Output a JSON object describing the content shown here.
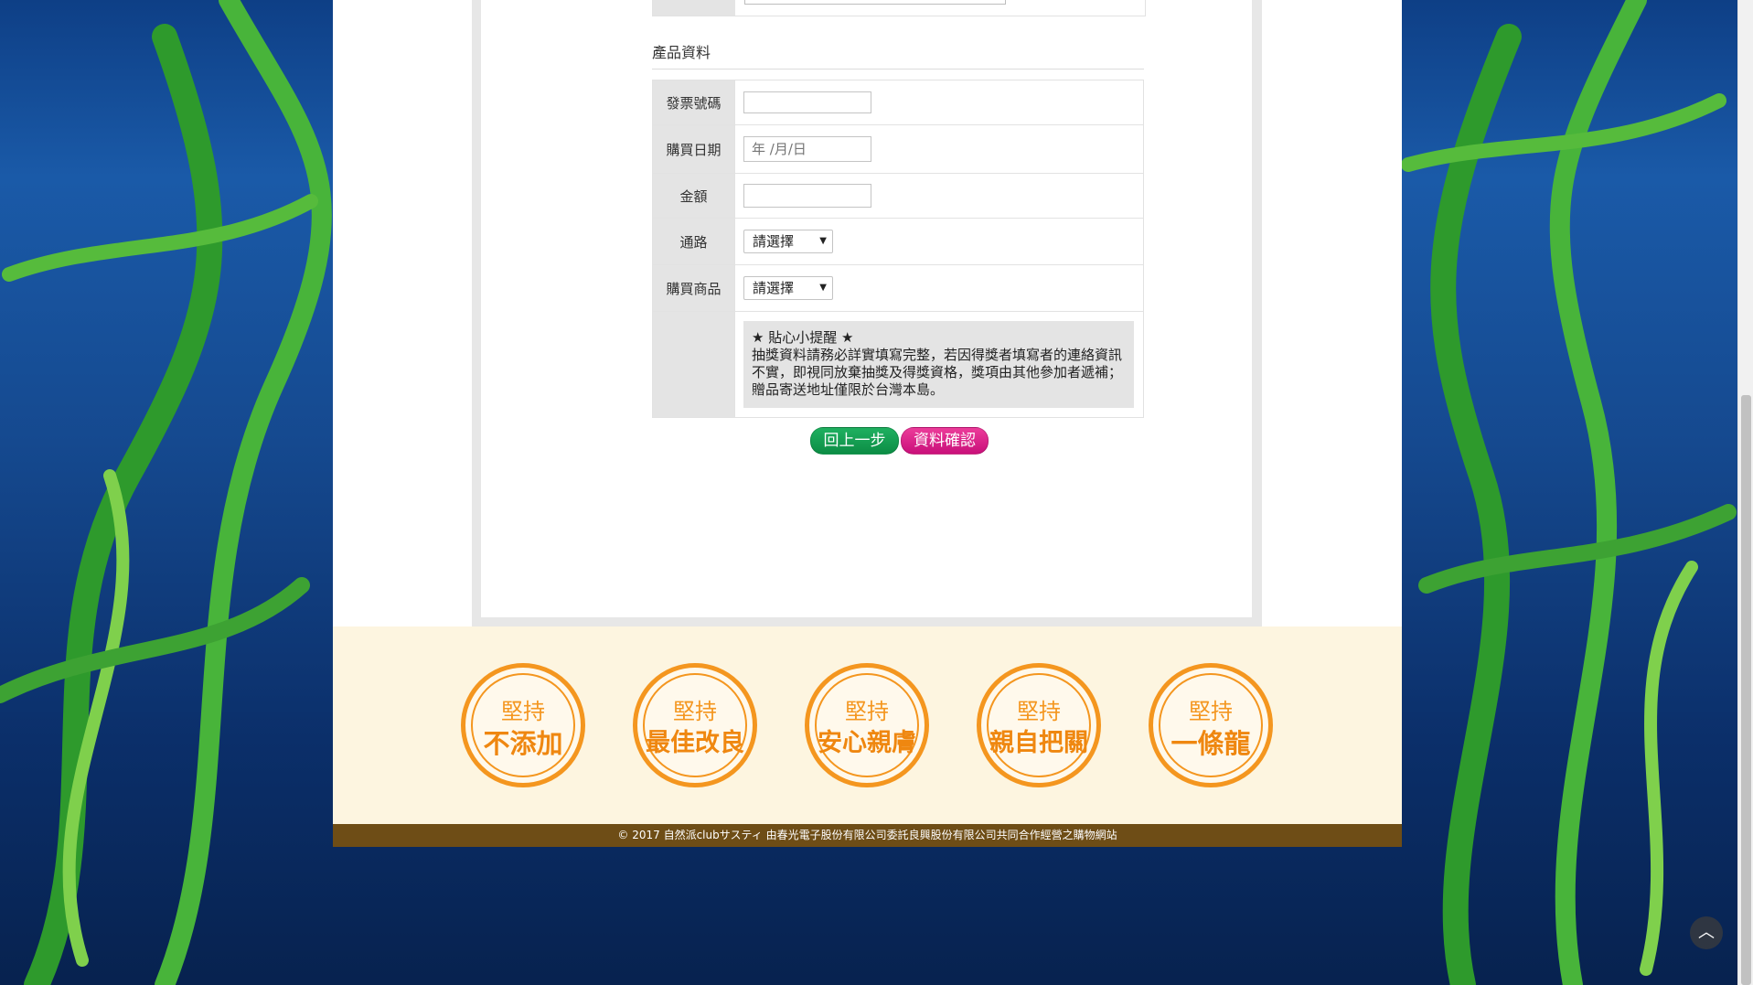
{
  "section": {
    "title": "產品資料"
  },
  "form": {
    "invoice_label": "發票號碼",
    "date_label": "購買日期",
    "date_placeholder": "年 /月/日",
    "amount_label": "金額",
    "channel_label": "通路",
    "channel_value": "請選擇",
    "product_label": "購買商品",
    "product_value": "請選擇"
  },
  "notice": {
    "title": "★ 貼心小提醒 ★",
    "body": "抽獎資料請務必詳實填寫完整，若因得獎者填寫者的連絡資訊不實，即視同放棄抽獎及得獎資格，獎項由其他參加者遞補；贈品寄送地址僅限於台灣本島。"
  },
  "buttons": {
    "back": "回上一步",
    "confirm": "資料確認"
  },
  "badges": [
    {
      "line1": "堅持",
      "line2": "不添加"
    },
    {
      "line1": "堅持",
      "line2": "最佳改良"
    },
    {
      "line1": "堅持",
      "line2": "安心親膚"
    },
    {
      "line1": "堅持",
      "line2": "親自把關"
    },
    {
      "line1": "堅持",
      "line2": "一條龍"
    }
  ],
  "footer": {
    "copyright": "© 2017 自然派clubサスティ 由春光電子股份有限公司委託良興股份有限公司共同合作經營之購物網站"
  },
  "icons": {
    "scroll_top": "chevron-up-icon"
  },
  "colors": {
    "accent_orange": "#f4961f",
    "back_green": "#0c8d45",
    "confirm_pink": "#c9107a",
    "footer_brown": "#6e4d16"
  }
}
